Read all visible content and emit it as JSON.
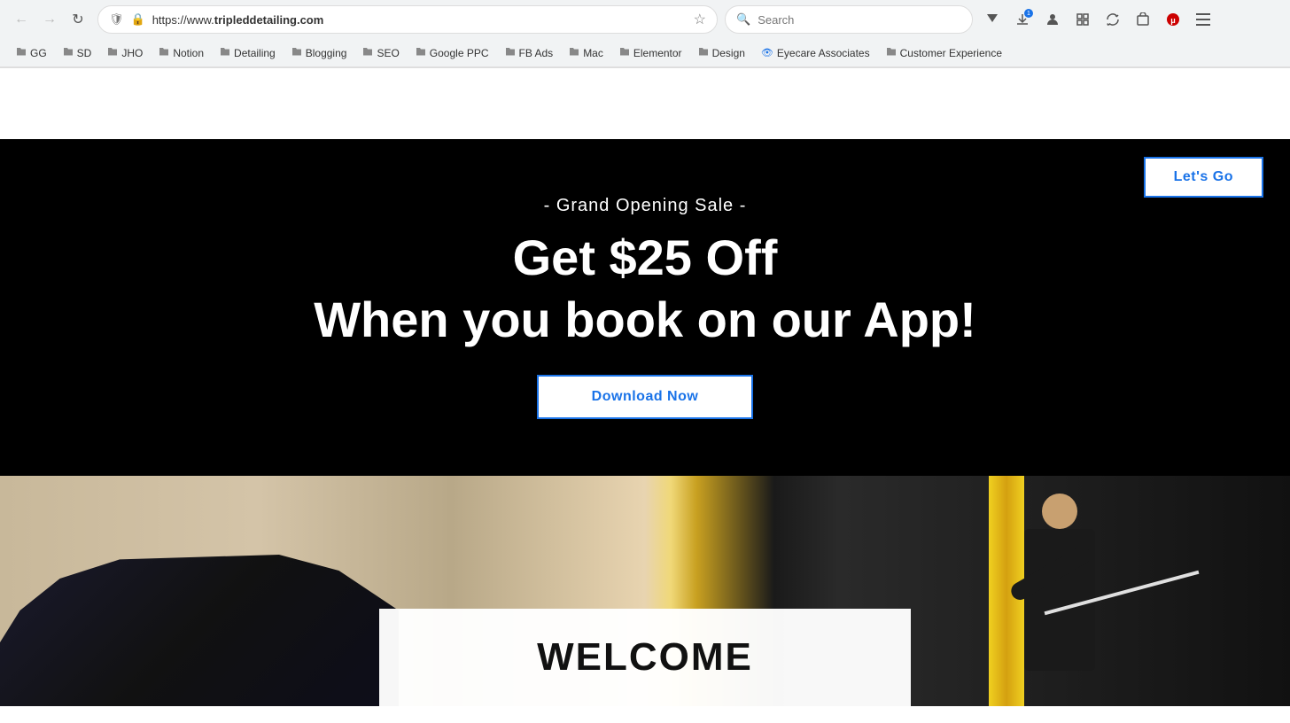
{
  "browser": {
    "url_prefix": "https://www.",
    "url_domain": "tripleddetailing.com",
    "url_full": "https://www.tripleddetailing.com",
    "back_btn": "←",
    "forward_btn": "→",
    "reload_btn": "↺",
    "star_label": "★",
    "search_placeholder": "Search"
  },
  "bookmarks": [
    {
      "label": "GG",
      "icon": "📁"
    },
    {
      "label": "SD",
      "icon": "📁"
    },
    {
      "label": "JHO",
      "icon": "📁"
    },
    {
      "label": "Notion",
      "icon": "📁"
    },
    {
      "label": "Detailing",
      "icon": "📁"
    },
    {
      "label": "Blogging",
      "icon": "📁"
    },
    {
      "label": "SEO",
      "icon": "📁"
    },
    {
      "label": "Google PPC",
      "icon": "📁"
    },
    {
      "label": "FB Ads",
      "icon": "📁"
    },
    {
      "label": "Mac",
      "icon": "📁"
    },
    {
      "label": "Elementor",
      "icon": "📁"
    },
    {
      "label": "Design",
      "icon": "📁"
    },
    {
      "label": "Eyecare Associates",
      "icon": "🔵"
    },
    {
      "label": "Customer Experience",
      "icon": "📁"
    }
  ],
  "hero": {
    "subtitle": "- Grand Opening Sale -",
    "title_main": "Get $25 Off",
    "title_sub": "When you book on our App!",
    "download_btn": "Download Now",
    "lets_go_btn": "Let's Go"
  },
  "welcome": {
    "title": "WELCOME"
  }
}
